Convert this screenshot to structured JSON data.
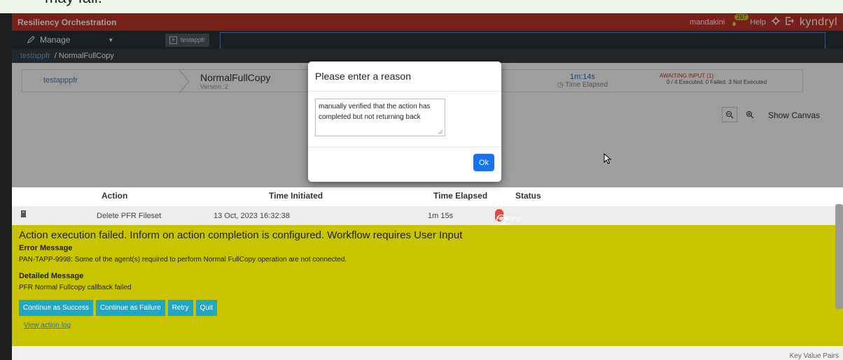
{
  "top_strip_text": "may fail.",
  "header": {
    "title": "Resiliency Orchestration",
    "user": "mandakini",
    "notification_count": "297",
    "help": "Help",
    "brand": "kyndryl",
    "accent_color": "#c0352b"
  },
  "toolbar": {
    "manage_label": "Manage",
    "tab_label": "testappfr"
  },
  "breadcrumb": {
    "parent": "testappfr",
    "current": "/ NormalFullCopy"
  },
  "pipeline": {
    "app": "testapppfr",
    "workflow_name": "NormalFullCopy",
    "version": "Version :2",
    "time_value": "1m:14s",
    "time_label": "Time Elapsed",
    "status": "AWAITING INPUT (1)",
    "counts": "0 / 4 Executed. 0 Failed. 3 Not Executed"
  },
  "canvas": {
    "show_canvas": "Show Canvas"
  },
  "grid": {
    "headers": {
      "action": "Action",
      "time_initiated": "Time Initiated",
      "time_elapsed": "Time Elapsed",
      "status": "Status"
    },
    "row": {
      "action": "Delete PFR Fileset",
      "time_initiated": "13 Oct, 2023 16:32:38",
      "time_elapsed": "1m 15s",
      "status": "Awaiting Input",
      "status_color": "#e24a3f"
    }
  },
  "error_panel": {
    "title": "Action execution failed. Inform on action completion is configured. Workflow requires User Input",
    "error_label": "Error Message",
    "error_text": "PAN-TAPP-9998: Some of the agent(s) required to perform Normal FullCopy operation are not connected.",
    "detail_label": "Detailed Message",
    "detail_text": "PFR Normal Fullcopy callback failed",
    "buttons": [
      "Continue as Success",
      "Continue as Failure",
      "Retry",
      "Quit"
    ],
    "log_link": "View action log",
    "background": "#c9c400"
  },
  "footer": {
    "key_value": "Key Value Pairs"
  },
  "modal": {
    "title": "Please enter a reason",
    "reason_value": "manually verified that the action has completed but not returning back",
    "ok_label": "Ok"
  }
}
